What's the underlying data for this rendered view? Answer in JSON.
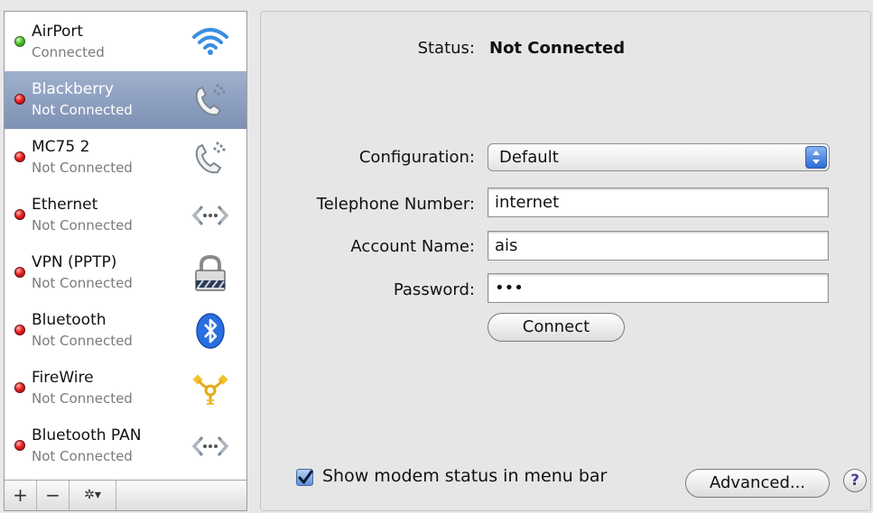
{
  "services": [
    {
      "name": "AirPort",
      "status": "Connected",
      "connected": true,
      "selected": false,
      "icon": "wifi-icon"
    },
    {
      "name": "Blackberry",
      "status": "Not Connected",
      "connected": false,
      "selected": true,
      "icon": "phone-modem-icon"
    },
    {
      "name": "MC75 2",
      "status": "Not Connected",
      "connected": false,
      "selected": false,
      "icon": "phone-modem-icon"
    },
    {
      "name": "Ethernet",
      "status": "Not Connected",
      "connected": false,
      "selected": false,
      "icon": "ethernet-icon"
    },
    {
      "name": "VPN (PPTP)",
      "status": "Not Connected",
      "connected": false,
      "selected": false,
      "icon": "vpn-lock-icon"
    },
    {
      "name": "Bluetooth",
      "status": "Not Connected",
      "connected": false,
      "selected": false,
      "icon": "bluetooth-icon"
    },
    {
      "name": "FireWire",
      "status": "Not Connected",
      "connected": false,
      "selected": false,
      "icon": "firewire-icon"
    },
    {
      "name": "Bluetooth PAN",
      "status": "Not Connected",
      "connected": false,
      "selected": false,
      "icon": "ethernet-icon"
    }
  ],
  "sidebar_toolbar": {
    "add": "+",
    "remove": "−",
    "action": "✲▾"
  },
  "detail": {
    "status_label": "Status:",
    "status_value": "Not Connected",
    "configuration_label": "Configuration:",
    "configuration_value": "Default",
    "telephone_label": "Telephone Number:",
    "telephone_value": "internet",
    "account_label": "Account Name:",
    "account_value": "ais",
    "password_label": "Password:",
    "password_value": "•••",
    "connect_button": "Connect",
    "show_modem_status_label": "Show modem status in menu bar",
    "show_modem_status_checked": true,
    "advanced_button": "Advanced...",
    "help_button": "?"
  },
  "colors": {
    "selection": "#8fa2c4",
    "status_red": "#e02020",
    "status_green": "#4cbf2a",
    "popup_blue": "#3b78dc"
  }
}
